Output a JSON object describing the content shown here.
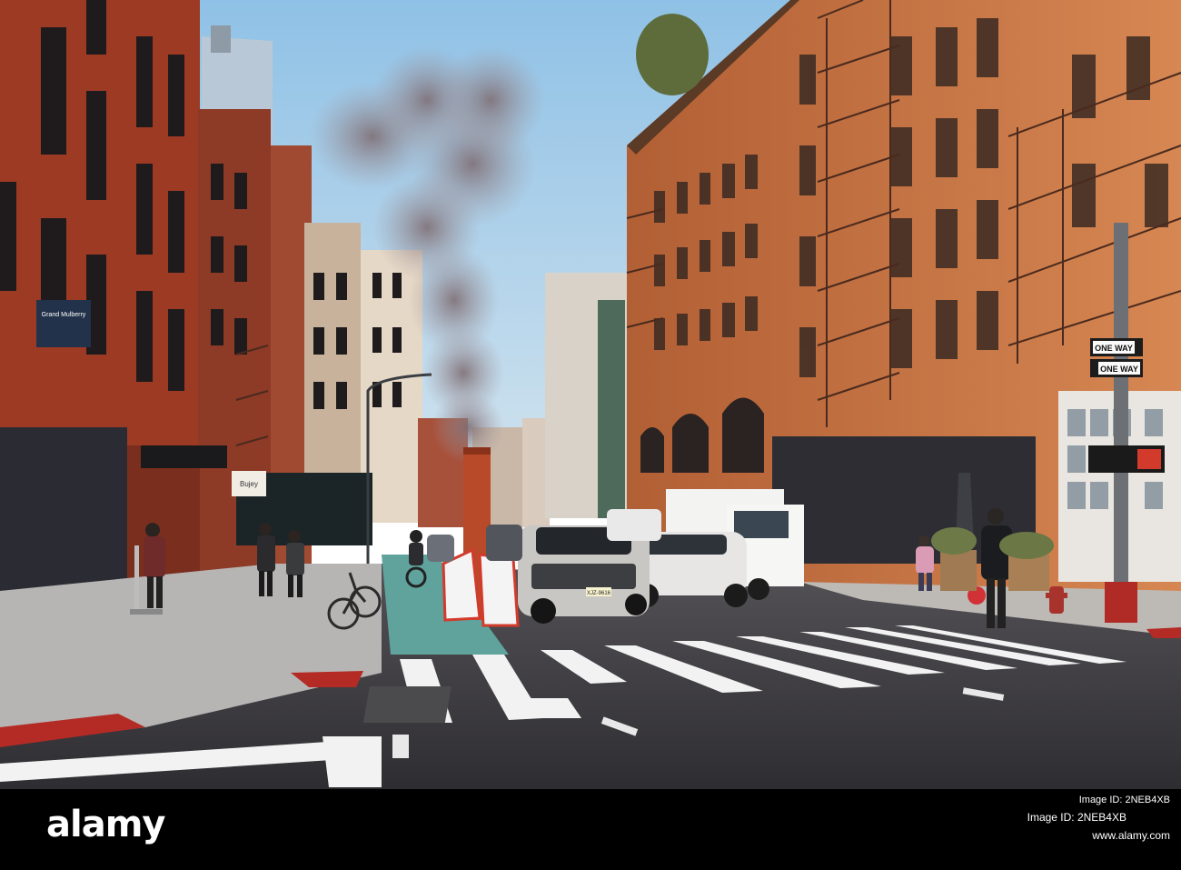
{
  "watermark": {
    "brand": "alamy",
    "image_id_label": "Image ID: 2NEB4XB",
    "image_id_secondary": "Image ID: 2NEB4XB",
    "url": "www.alamy.com"
  },
  "signs": {
    "one_way_top": "ONE WAY",
    "one_way_bottom": "ONE WAY",
    "store_sign": "Grand Mulberry",
    "storefront_left": "Bujey",
    "plate": "XJZ-9616"
  },
  "colors": {
    "sky": "#a9cde8",
    "brick_left": "#9c3a23",
    "brick_right": "#c8703f",
    "asphalt": "#3b3b3f",
    "bike_lane": "#5fa39c",
    "crosswalk": "#f2f2f2"
  }
}
